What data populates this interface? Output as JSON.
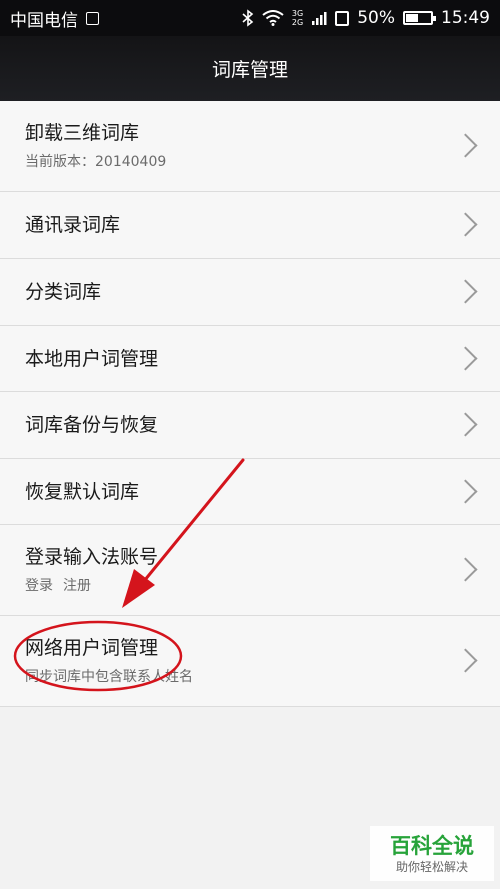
{
  "status_bar": {
    "carrier": "中国电信",
    "network_top": "3G",
    "network_bottom": "2G",
    "battery": "50%",
    "battery_level": 0.5,
    "time": "15:49"
  },
  "header": {
    "title": "词库管理"
  },
  "items": [
    {
      "label": "卸载三维词库",
      "sub": "当前版本：20140409"
    },
    {
      "label": "通讯录词库"
    },
    {
      "label": "分类词库"
    },
    {
      "label": "本地用户词管理"
    },
    {
      "label": "词库备份与恢复"
    },
    {
      "label": "恢复默认词库"
    },
    {
      "label": "登录输入法账号",
      "links": [
        "登录",
        "注册"
      ]
    },
    {
      "label": "网络用户词管理",
      "sub": "同步词库中包含联系人姓名"
    }
  ],
  "watermark": {
    "title": "百科全说",
    "subtitle": "助你轻松解决"
  },
  "colors": {
    "annotation": "#d4141c",
    "watermark_green": "#27a33a"
  }
}
